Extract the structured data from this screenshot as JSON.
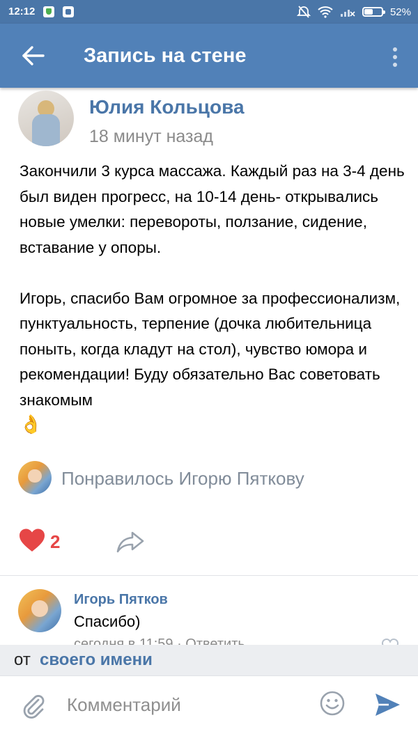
{
  "status_bar": {
    "time": "12:12",
    "battery": "52%",
    "battery_level": 0.52
  },
  "header": {
    "title": "Запись на стене",
    "back_icon": "arrow-left-icon",
    "menu_icon": "more-vert-icon"
  },
  "post": {
    "author": "Юлия Кольцова",
    "time": "18 минут назад",
    "text": "Закончили 3 курса массажа. Каждый раз на 3-4 день был виден прогресс, на 10-14 день- открывались новые умелки: перевороты, ползание, сидение, вставание у опоры.\n\nИгорь, спасибо Вам огромное за профессионализм, пунктуальность, терпение (дочка любительница поныть, когда кладут на стол), чувство юмора и рекомендации! Буду обязательно Вас советовать знакомым",
    "emoji": "👌",
    "liked_by": "Понравилось Игорю Пяткову",
    "likes_count": "2"
  },
  "comment": {
    "author": "Игорь Пятков",
    "text": "Спасибо)",
    "meta": "сегодня в 11:59 · Ответить"
  },
  "from_bar": {
    "prefix": "от",
    "name": "своего имени"
  },
  "composer": {
    "placeholder": "Комментарий"
  },
  "colors": {
    "header": "#5181b8",
    "status_bar": "#4a76a8",
    "link": "#4a76a8",
    "like": "#e64646"
  }
}
